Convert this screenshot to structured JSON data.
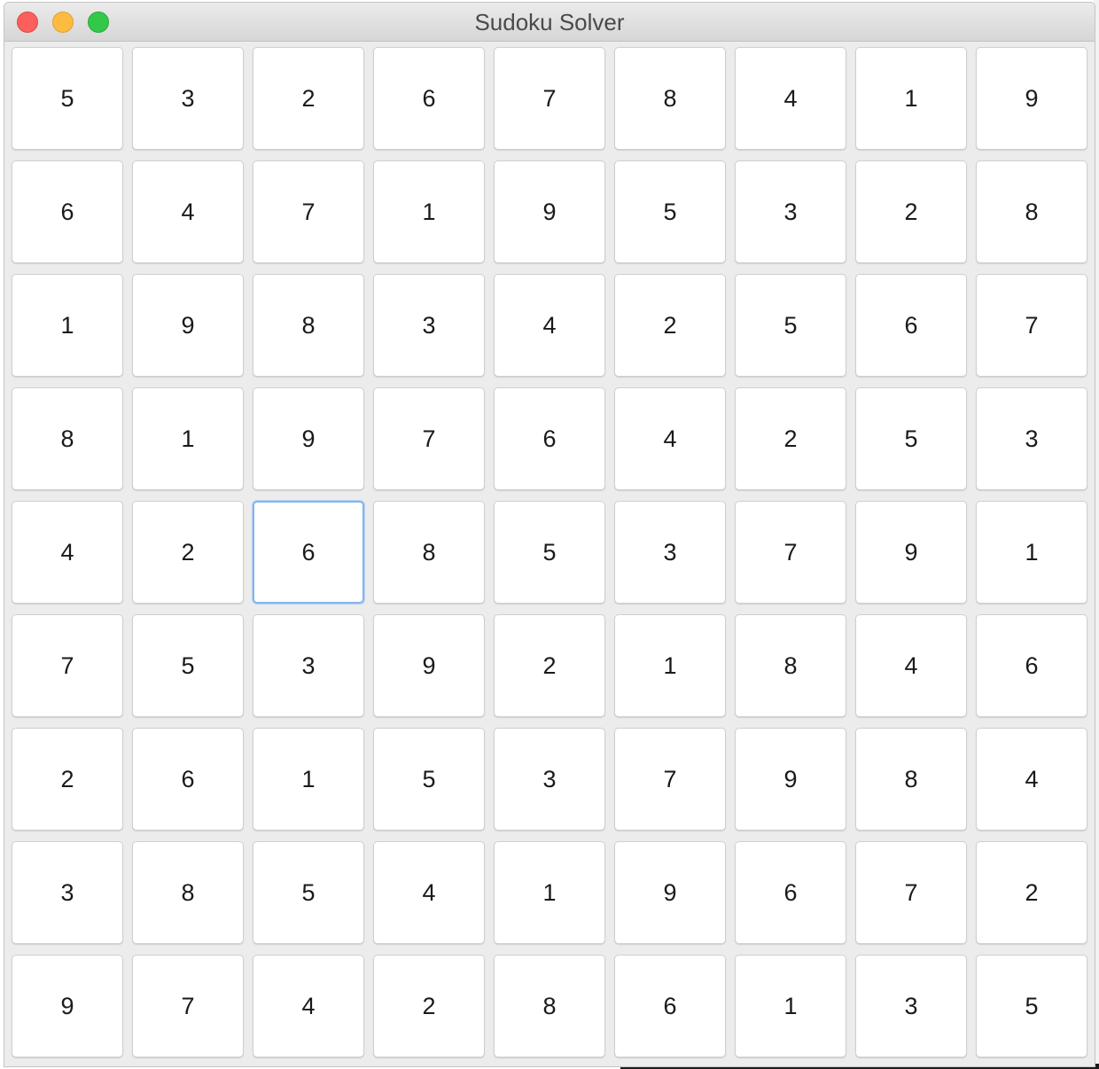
{
  "window": {
    "title": "Sudoku Solver"
  },
  "board": {
    "rows": [
      [
        "5",
        "3",
        "2",
        "6",
        "7",
        "8",
        "4",
        "1",
        "9"
      ],
      [
        "6",
        "4",
        "7",
        "1",
        "9",
        "5",
        "3",
        "2",
        "8"
      ],
      [
        "1",
        "9",
        "8",
        "3",
        "4",
        "2",
        "5",
        "6",
        "7"
      ],
      [
        "8",
        "1",
        "9",
        "7",
        "6",
        "4",
        "2",
        "5",
        "3"
      ],
      [
        "4",
        "2",
        "6",
        "8",
        "5",
        "3",
        "7",
        "9",
        "1"
      ],
      [
        "7",
        "5",
        "3",
        "9",
        "2",
        "1",
        "8",
        "4",
        "6"
      ],
      [
        "2",
        "6",
        "1",
        "5",
        "3",
        "7",
        "9",
        "8",
        "4"
      ],
      [
        "3",
        "8",
        "5",
        "4",
        "1",
        "9",
        "6",
        "7",
        "2"
      ],
      [
        "9",
        "7",
        "4",
        "2",
        "8",
        "6",
        "1",
        "3",
        "5"
      ]
    ],
    "focused_cell": {
      "row": 4,
      "col": 2
    }
  },
  "colors": {
    "focus_ring": "#86b4ec",
    "close_button": "#fc605c",
    "minimize_button": "#fdbc40",
    "zoom_button": "#34c84a"
  }
}
